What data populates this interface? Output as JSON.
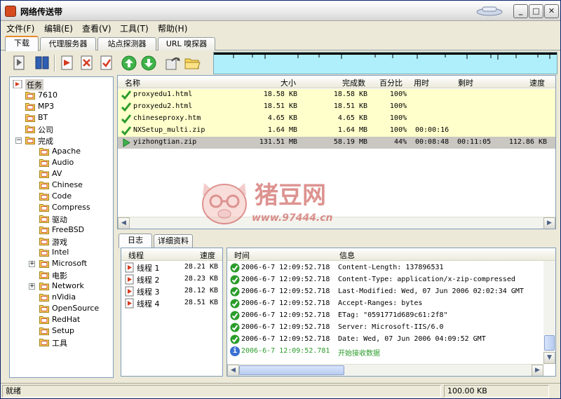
{
  "app": {
    "title": "网络传送带"
  },
  "menu": [
    "文件(F)",
    "编辑(E)",
    "查看(V)",
    "工具(T)",
    "帮助(H)"
  ],
  "tabs": [
    "下载",
    "代理服务器",
    "站点探测器",
    "URL 嗅探器"
  ],
  "toolbar": {
    "icons": [
      "new-task-icon",
      "properties-icon",
      "start-icon",
      "delete-icon",
      "check-icon",
      "move-up-icon",
      "move-down-icon",
      "open-icon",
      "folder-icon"
    ]
  },
  "tree": {
    "root": "任务",
    "items": [
      "7610",
      "MP3",
      "BT",
      "公司",
      "完成"
    ],
    "done_children": [
      "Apache",
      "Audio",
      "AV",
      "Chinese",
      "Code",
      "Compress",
      "驱动",
      "FreeBSD",
      "游戏",
      "Intel",
      "Microsoft",
      "电影",
      "Network",
      "nVidia",
      "OpenSource",
      "RedHat",
      "Setup",
      "工具"
    ]
  },
  "files": {
    "columns": [
      "名称",
      "大小",
      "完成数",
      "百分比",
      "用时",
      "剩时",
      "速度"
    ],
    "rows": [
      {
        "name": "proxyedu1.html",
        "size": "18.58 KB",
        "done": "18.58 KB",
        "pct": "100%",
        "elapsed": "",
        "remain": "",
        "speed": "",
        "status": "done"
      },
      {
        "name": "proxyedu2.html",
        "size": "18.51 KB",
        "done": "18.51 KB",
        "pct": "100%",
        "elapsed": "",
        "remain": "",
        "speed": "",
        "status": "done"
      },
      {
        "name": "chineseproxy.htm",
        "size": "4.65 KB",
        "done": "4.65 KB",
        "pct": "100%",
        "elapsed": "",
        "remain": "",
        "speed": "",
        "status": "done"
      },
      {
        "name": "NXSetup_multi.zip",
        "size": "1.64 MB",
        "done": "1.64 MB",
        "pct": "100%",
        "elapsed": "00:00:16",
        "remain": "",
        "speed": "",
        "status": "done"
      },
      {
        "name": "yizhongtian.zip",
        "size": "131.51 MB",
        "done": "58.19 MB",
        "pct": "44%",
        "elapsed": "00:08:48",
        "remain": "00:11:05",
        "speed": "112.86 KB",
        "status": "active"
      }
    ]
  },
  "bottom_tabs": [
    "日志",
    "详细资料"
  ],
  "threads": {
    "columns": [
      "线程",
      "速度"
    ],
    "rows": [
      {
        "name": "线程 1",
        "speed": "28.21 KB"
      },
      {
        "name": "线程 2",
        "speed": "28.23 KB"
      },
      {
        "name": "线程 3",
        "speed": "28.12 KB"
      },
      {
        "name": "线程 4",
        "speed": "28.51 KB"
      }
    ]
  },
  "log": {
    "columns": [
      "时间",
      "信息"
    ],
    "rows": [
      {
        "time": "2006-6-7 12:09:52.718",
        "msg": "Content-Length: 137896531",
        "type": "ok"
      },
      {
        "time": "2006-6-7 12:09:52.718",
        "msg": "Content-Type: application/x-zip-compressed",
        "type": "ok"
      },
      {
        "time": "2006-6-7 12:09:52.718",
        "msg": "Last-Modified: Wed, 07 Jun 2006 02:02:34 GMT",
        "type": "ok"
      },
      {
        "time": "2006-6-7 12:09:52.718",
        "msg": "Accept-Ranges: bytes",
        "type": "ok"
      },
      {
        "time": "2006-6-7 12:09:52.718",
        "msg": "ETag: \"0591771d689c61:2f8\"",
        "type": "ok"
      },
      {
        "time": "2006-6-7 12:09:52.718",
        "msg": "Server: Microsoft-IIS/6.0",
        "type": "ok"
      },
      {
        "time": "2006-6-7 12:09:52.718",
        "msg": "Date: Wed, 07 Jun 2006 04:09:52 GMT",
        "type": "ok"
      },
      {
        "time": "2006-6-7 12:09:52.781",
        "msg": "开始接收数据",
        "type": "info"
      }
    ]
  },
  "status": {
    "text": "就绪",
    "speed": "100.00 KB"
  },
  "watermark": {
    "text": "猪豆网",
    "url": "www.97444.cn"
  },
  "colors": {
    "done_green": "#2a9c2a",
    "info_blue": "#3a6fd1",
    "row_yellow": "#ffffcc",
    "graph_cyan": "#aeeffb"
  }
}
